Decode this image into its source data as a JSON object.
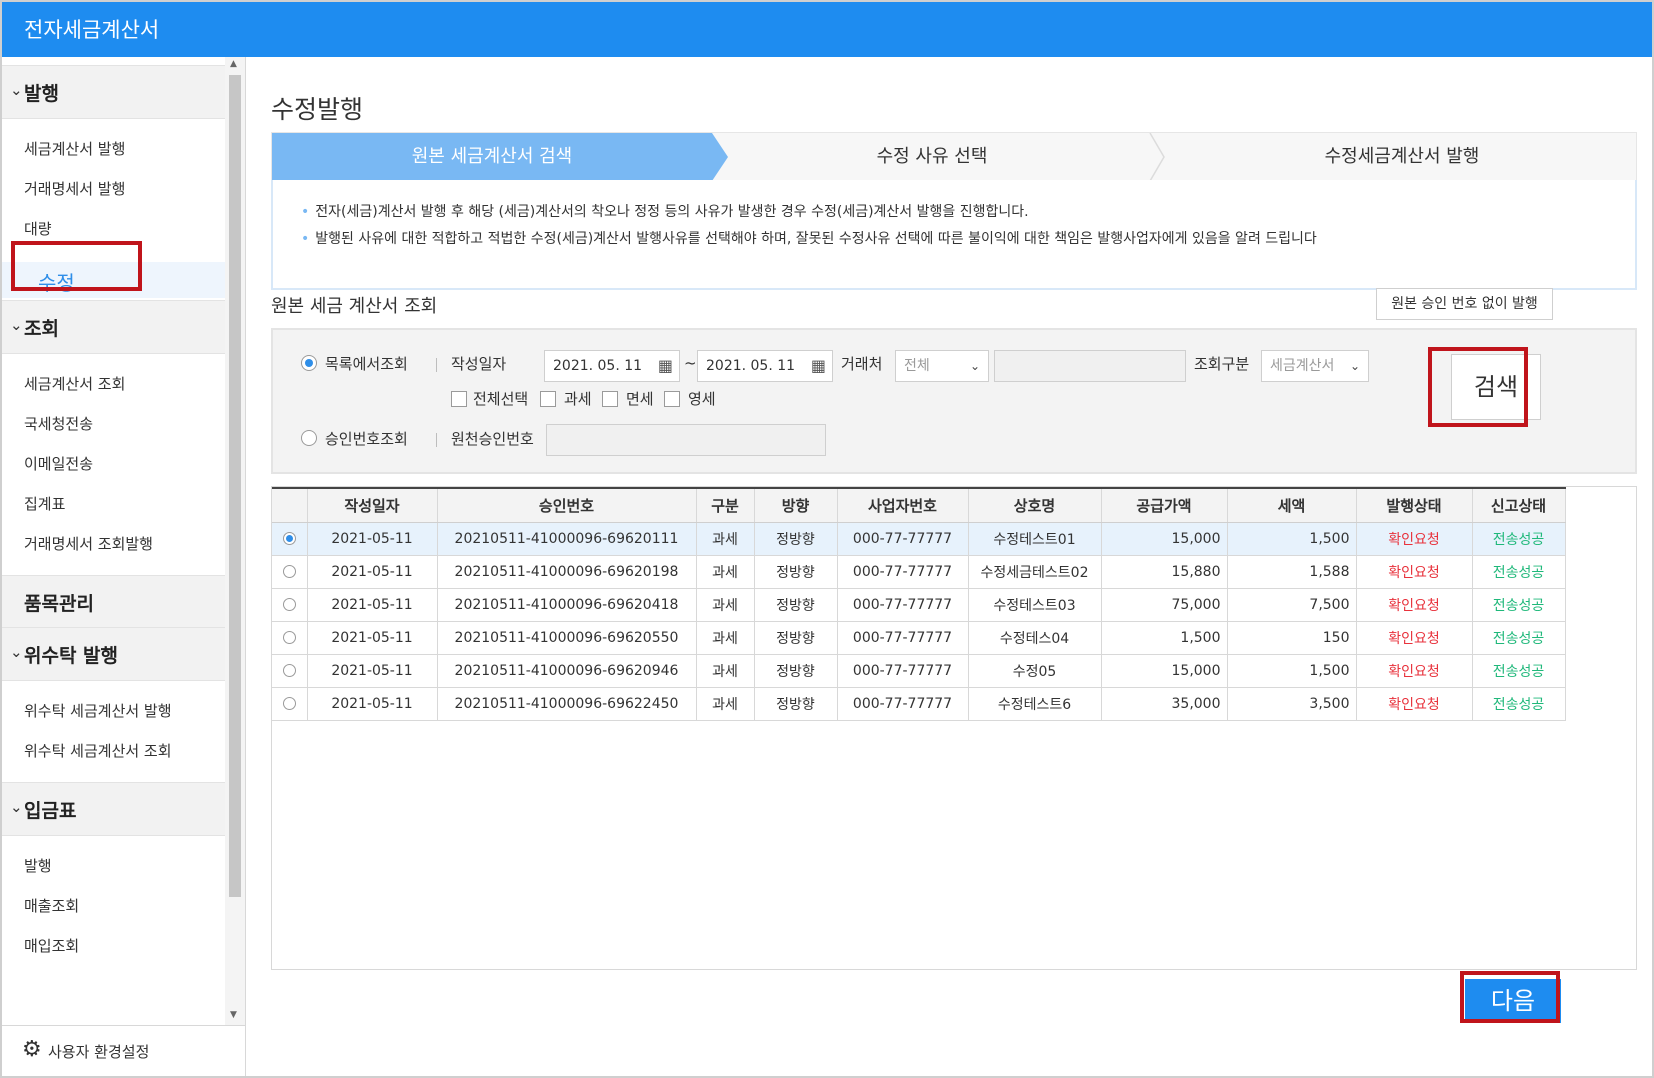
{
  "app": {
    "title": "전자세금계산서"
  },
  "sidebar": {
    "sections": [
      {
        "label": "발행",
        "items": [
          "세금계산서 발행",
          "거래명세서 발행",
          "대량",
          "수정"
        ],
        "active": "수정"
      },
      {
        "label": "조회",
        "items": [
          "세금계산서 조회",
          "국세청전송",
          "이메일전송",
          "집계표",
          "거래명세서 조회발행"
        ]
      },
      {
        "label": "품목관리",
        "items": []
      },
      {
        "label": "위수탁 발행",
        "items": [
          "위수탁 세금계산서 발행",
          "위수탁 세금계산서 조회"
        ]
      },
      {
        "label": "입금표",
        "items": [
          "발행",
          "매출조회",
          "매입조회"
        ]
      }
    ],
    "settings_label": "사용자 환경설정"
  },
  "page": {
    "title": "수정발행",
    "steps": [
      "원본 세금계산서 검색",
      "수정 사유 선택",
      "수정세금계산서 발행"
    ],
    "notices": [
      "전자(세금)계산서 발행 후 해당 (세금)계산서의 착오나 정정 등의 사유가 발생한 경우 수정(세금)계산서 발행을 진행합니다.",
      "발행된 사유에 대한 적합하고 적법한 수정(세금)계산서 발행사유를 선택해야 하며, 잘못된 수정사유 선택에 따른 불이익에 대한 책임은 발행사업자에게 있음을 알려 드립니다"
    ],
    "section_title": "원본 세금 계산서 조회",
    "no_approval_button": "원본 승인 번호 없이 발행"
  },
  "search": {
    "mode_list": "목록에서조회",
    "mode_approval": "승인번호조회",
    "date_label": "작성일자",
    "date_from": "2021. 05. 11",
    "date_to": "2021. 05. 11",
    "date_tilde": "~",
    "partner_label": "거래처",
    "partner_select": "전체",
    "query_type_label": "조회구분",
    "query_type_select": "세금계산서",
    "checks": [
      "전체선택",
      "과세",
      "면세",
      "영세"
    ],
    "approval_label": "원천승인번호",
    "search_button": "검색"
  },
  "table": {
    "headers": [
      "",
      "작성일자",
      "승인번호",
      "구분",
      "방향",
      "사업자번호",
      "상호명",
      "공급가액",
      "세액",
      "발행상태",
      "신고상태"
    ],
    "rows": [
      [
        "2021-05-11",
        "20210511-41000096-69620111",
        "과세",
        "정방향",
        "000-77-77777",
        "수정테스트01",
        "15,000",
        "1,500",
        "확인요청",
        "전송성공"
      ],
      [
        "2021-05-11",
        "20210511-41000096-69620198",
        "과세",
        "정방향",
        "000-77-77777",
        "수정세금테스트02",
        "15,880",
        "1,588",
        "확인요청",
        "전송성공"
      ],
      [
        "2021-05-11",
        "20210511-41000096-69620418",
        "과세",
        "정방향",
        "000-77-77777",
        "수정테스트03",
        "75,000",
        "7,500",
        "확인요청",
        "전송성공"
      ],
      [
        "2021-05-11",
        "20210511-41000096-69620550",
        "과세",
        "정방향",
        "000-77-77777",
        "수정테스04",
        "1,500",
        "150",
        "확인요청",
        "전송성공"
      ],
      [
        "2021-05-11",
        "20210511-41000096-69620946",
        "과세",
        "정방향",
        "000-77-77777",
        "수정05",
        "15,000",
        "1,500",
        "확인요청",
        "전송성공"
      ],
      [
        "2021-05-11",
        "20210511-41000096-69622450",
        "과세",
        "정방향",
        "000-77-77777",
        "수정테스트6",
        "35,000",
        "3,500",
        "확인요청",
        "전송성공"
      ]
    ],
    "selected_row": 0
  },
  "footer": {
    "next_button": "다음"
  },
  "colors": {
    "accent": "#1e8cf0",
    "step_active": "#79b8f3",
    "highlight": "#c0141b",
    "status_red": "#e8323c",
    "status_green": "#1fb87a"
  }
}
